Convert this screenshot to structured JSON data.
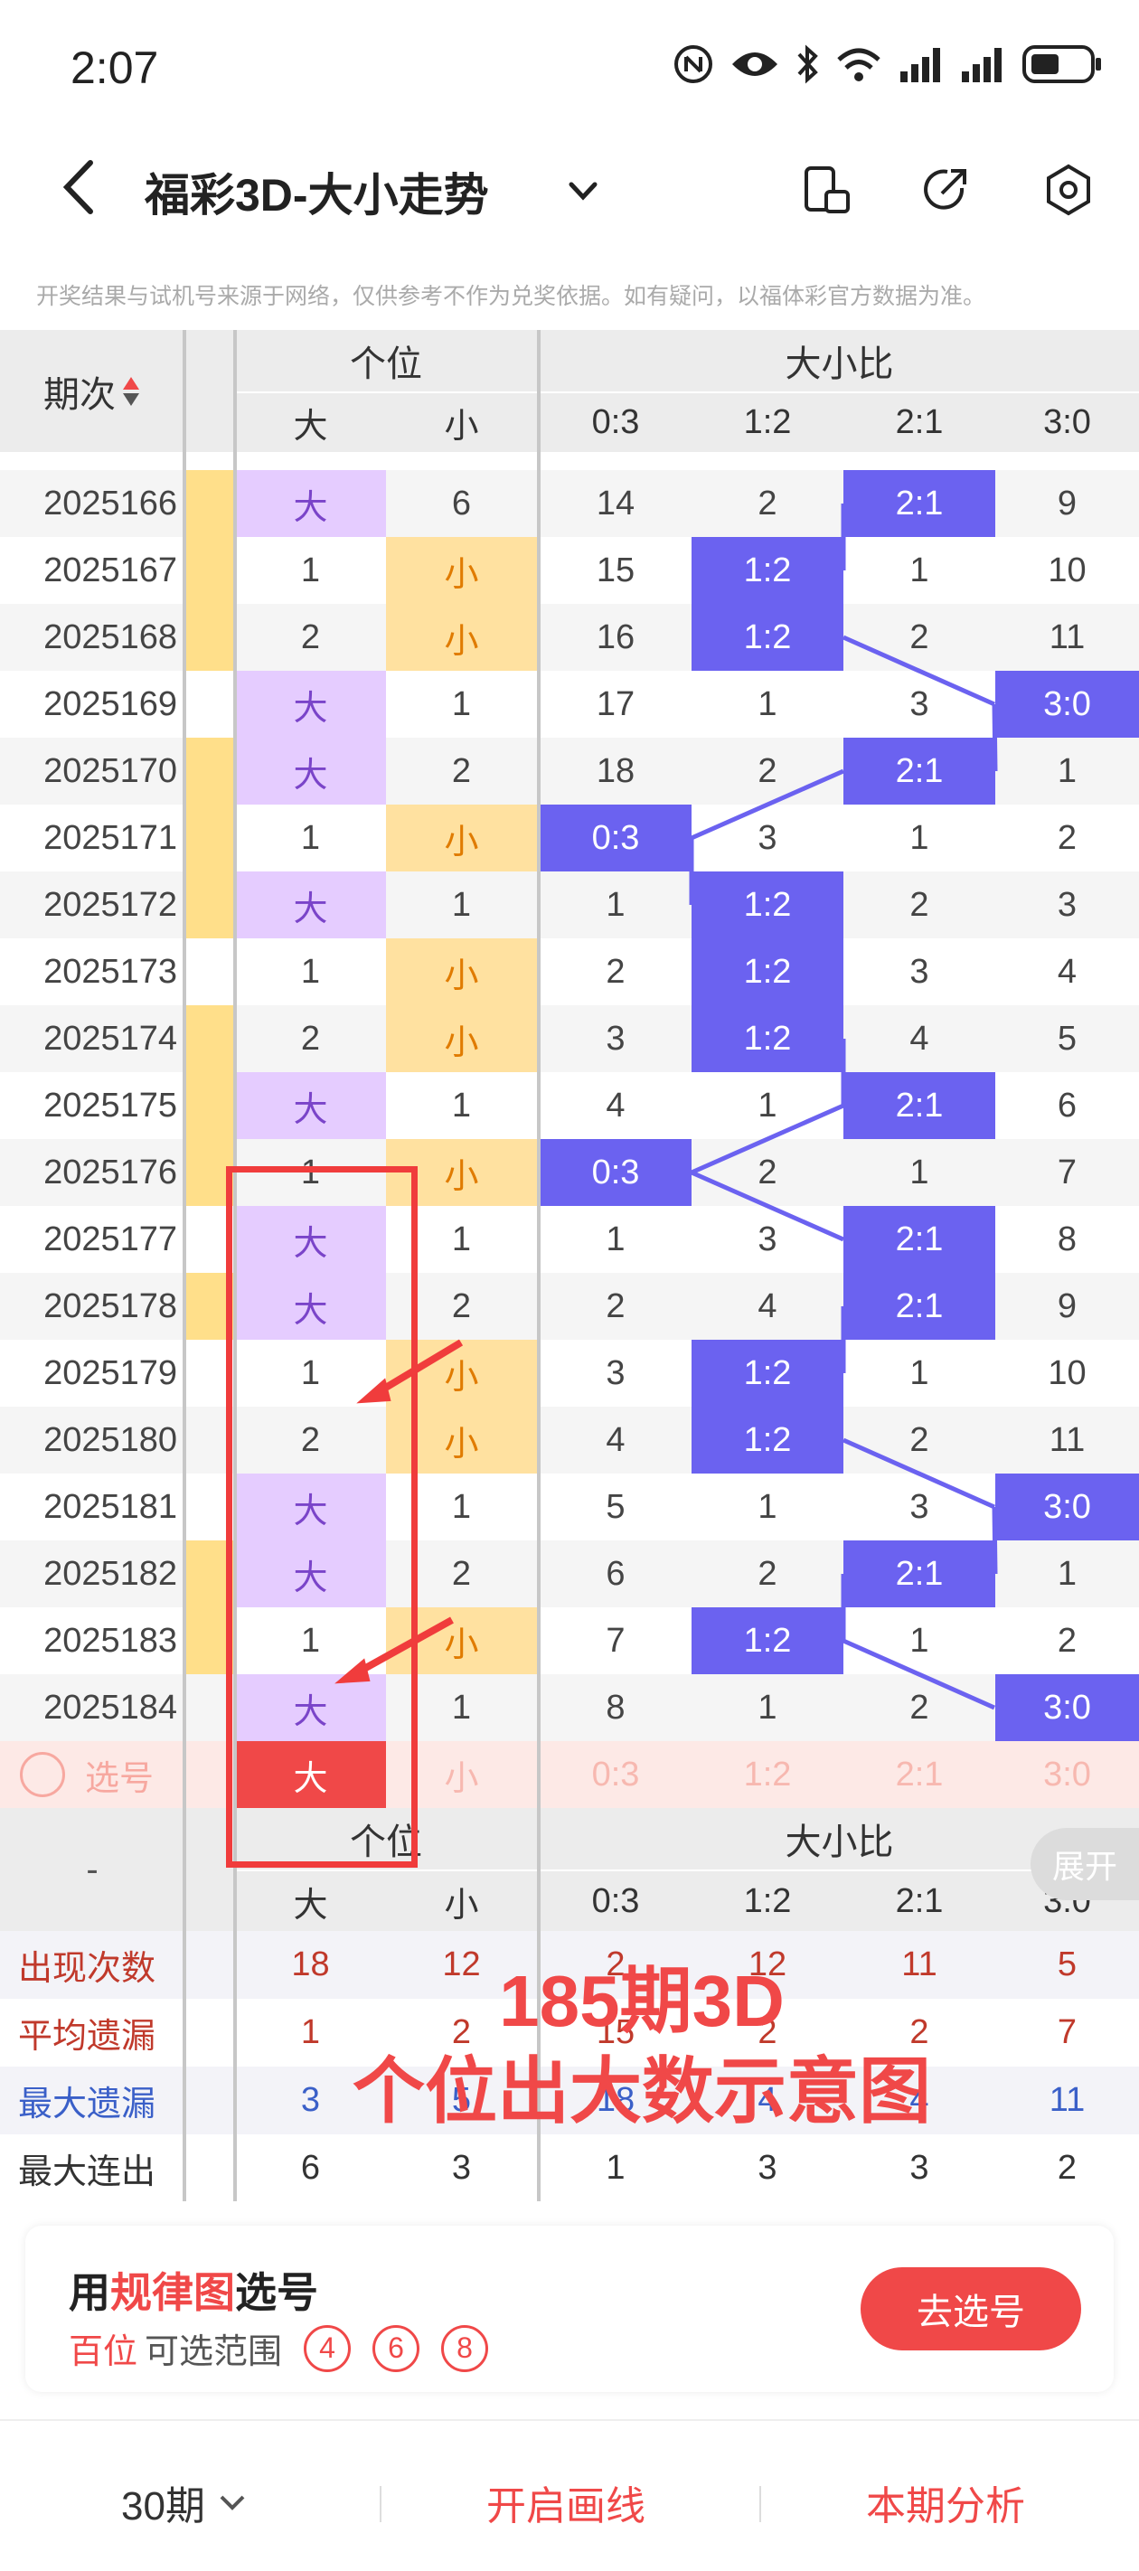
{
  "status_bar": {
    "time": "2:07"
  },
  "header": {
    "title": "福彩3D-大小走势"
  },
  "notice": "开奖结果与试机号来源于网络，仅供参考不作为兑奖依据。如有疑问，以福体彩官方数据为准。",
  "table_header": {
    "period": "期次",
    "group1": "个位",
    "group2": "大小比",
    "cols": [
      "大",
      "小",
      "0:3",
      "1:2",
      "2:1",
      "3:0"
    ]
  },
  "rows": [
    {
      "period": "2025166",
      "d": "大",
      "x": "6",
      "r": [
        "14",
        "2",
        "2:1",
        "9"
      ],
      "hit": 2,
      "big": true
    },
    {
      "period": "2025167",
      "d": "1",
      "x": "小",
      "r": [
        "15",
        "1:2",
        "1",
        "10"
      ],
      "hit": 1,
      "big": false
    },
    {
      "period": "2025168",
      "d": "2",
      "x": "小",
      "r": [
        "16",
        "1:2",
        "2",
        "11"
      ],
      "hit": 1,
      "big": false
    },
    {
      "period": "2025169",
      "d": "大",
      "x": "1",
      "r": [
        "17",
        "1",
        "3",
        "3:0"
      ],
      "hit": 3,
      "big": true
    },
    {
      "period": "2025170",
      "d": "大",
      "x": "2",
      "r": [
        "18",
        "2",
        "2:1",
        "1"
      ],
      "hit": 2,
      "big": true
    },
    {
      "period": "2025171",
      "d": "1",
      "x": "小",
      "r": [
        "0:3",
        "3",
        "1",
        "2"
      ],
      "hit": 0,
      "big": false
    },
    {
      "period": "2025172",
      "d": "大",
      "x": "1",
      "r": [
        "1",
        "1:2",
        "2",
        "3"
      ],
      "hit": 1,
      "big": true
    },
    {
      "period": "2025173",
      "d": "1",
      "x": "小",
      "r": [
        "2",
        "1:2",
        "3",
        "4"
      ],
      "hit": 1,
      "big": false
    },
    {
      "period": "2025174",
      "d": "2",
      "x": "小",
      "r": [
        "3",
        "1:2",
        "4",
        "5"
      ],
      "hit": 1,
      "big": false
    },
    {
      "period": "2025175",
      "d": "大",
      "x": "1",
      "r": [
        "4",
        "1",
        "2:1",
        "6"
      ],
      "hit": 2,
      "big": true
    },
    {
      "period": "2025176",
      "d": "1",
      "x": "小",
      "r": [
        "0:3",
        "2",
        "1",
        "7"
      ],
      "hit": 0,
      "big": false
    },
    {
      "period": "2025177",
      "d": "大",
      "x": "1",
      "r": [
        "1",
        "3",
        "2:1",
        "8"
      ],
      "hit": 2,
      "big": true
    },
    {
      "period": "2025178",
      "d": "大",
      "x": "2",
      "r": [
        "2",
        "4",
        "2:1",
        "9"
      ],
      "hit": 2,
      "big": true
    },
    {
      "period": "2025179",
      "d": "1",
      "x": "小",
      "r": [
        "3",
        "1:2",
        "1",
        "10"
      ],
      "hit": 1,
      "big": false
    },
    {
      "period": "2025180",
      "d": "2",
      "x": "小",
      "r": [
        "4",
        "1:2",
        "2",
        "11"
      ],
      "hit": 1,
      "big": false
    },
    {
      "period": "2025181",
      "d": "大",
      "x": "1",
      "r": [
        "5",
        "1",
        "3",
        "3:0"
      ],
      "hit": 3,
      "big": true
    },
    {
      "period": "2025182",
      "d": "大",
      "x": "2",
      "r": [
        "6",
        "2",
        "2:1",
        "1"
      ],
      "hit": 2,
      "big": true
    },
    {
      "period": "2025183",
      "d": "1",
      "x": "小",
      "r": [
        "7",
        "1:2",
        "1",
        "2"
      ],
      "hit": 1,
      "big": false
    },
    {
      "period": "2025184",
      "d": "大",
      "x": "1",
      "r": [
        "8",
        "1",
        "2",
        "3:0"
      ],
      "hit": 3,
      "big": true
    }
  ],
  "select_row": {
    "label": "选号",
    "d": "大",
    "x": "小",
    "r": [
      "0:3",
      "1:2",
      "2:1",
      "3:0"
    ]
  },
  "footer_header": {
    "dash": "-",
    "group1": "个位",
    "group2": "大小比",
    "cols": [
      "大",
      "小",
      "0:3",
      "1:2",
      "2:1",
      "3:0"
    ],
    "expand": "展开"
  },
  "stats": [
    {
      "label": "出现次数",
      "values": [
        "18",
        "12",
        "2",
        "12",
        "11",
        "5"
      ]
    },
    {
      "label": "平均遗漏",
      "values": [
        "1",
        "2",
        "15",
        "2",
        "2",
        "7"
      ]
    },
    {
      "label": "最大遗漏",
      "values": [
        "3",
        "5",
        "18",
        "4",
        "4",
        "11"
      ]
    },
    {
      "label": "最大连出",
      "values": [
        "6",
        "3",
        "1",
        "3",
        "3",
        "2"
      ]
    }
  ],
  "overlay": {
    "line1": "185期3D",
    "line2": "个位出大数示意图"
  },
  "card": {
    "title_pre": "用",
    "title_red": "规律图",
    "title_post": "选号",
    "sub_red": "百位",
    "sub_post": "可选范围",
    "choices": [
      "4",
      "6",
      "8"
    ],
    "button": "去选号"
  },
  "bottom_bar": {
    "periods": "30期",
    "draw": "开启画线",
    "analysis": "本期分析"
  },
  "colors": {
    "accent_red": "#f04848",
    "blue": "#6b62f0",
    "purple": "#e5ccff",
    "orange": "#ffe1a0"
  }
}
